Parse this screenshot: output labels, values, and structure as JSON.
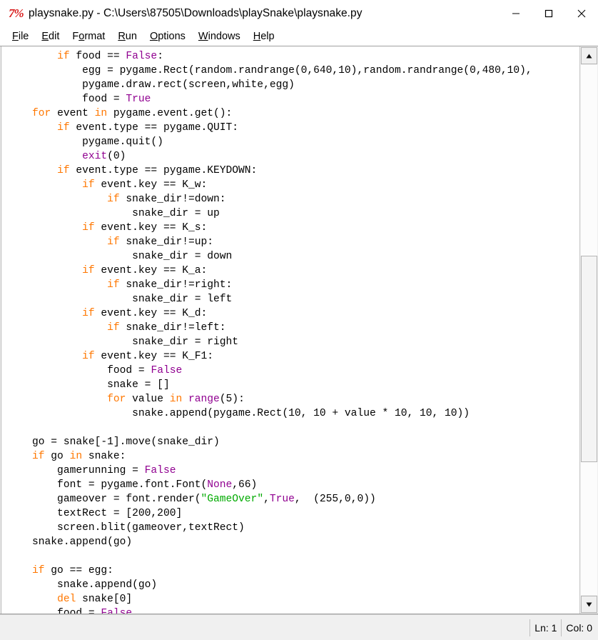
{
  "window": {
    "icon_name": "python-idle-icon",
    "icon_glyph": "7%",
    "title": "playsnake.py - C:\\Users\\87505\\Downloads\\playSnake\\playsnake.py",
    "controls": {
      "minimize": "minimize",
      "maximize": "maximize",
      "close": "close"
    }
  },
  "menubar": {
    "items": [
      {
        "label": "File",
        "accel_index": 0
      },
      {
        "label": "Edit",
        "accel_index": 0
      },
      {
        "label": "Format",
        "accel_index": 1
      },
      {
        "label": "Run",
        "accel_index": 0
      },
      {
        "label": "Options",
        "accel_index": 0
      },
      {
        "label": "Windows",
        "accel_index": 0
      },
      {
        "label": "Help",
        "accel_index": 0
      }
    ]
  },
  "editor": {
    "language": "python",
    "filename": "playsnake.py",
    "lines": [
      [
        {
          "t": "        ",
          "c": ""
        },
        {
          "t": "if",
          "c": "kw"
        },
        {
          "t": " food == ",
          "c": ""
        },
        {
          "t": "False",
          "c": "bi"
        },
        {
          "t": ":",
          "c": ""
        }
      ],
      [
        {
          "t": "            egg = pygame.Rect(random.randrange(0,640,10),random.randrange(0,480,10),",
          "c": ""
        }
      ],
      [
        {
          "t": "            pygame.draw.rect(screen,white,egg)",
          "c": ""
        }
      ],
      [
        {
          "t": "            food = ",
          "c": ""
        },
        {
          "t": "True",
          "c": "bi"
        }
      ],
      [
        {
          "t": "    ",
          "c": ""
        },
        {
          "t": "for",
          "c": "kw"
        },
        {
          "t": " event ",
          "c": ""
        },
        {
          "t": "in",
          "c": "kw"
        },
        {
          "t": " pygame.event.get():",
          "c": ""
        }
      ],
      [
        {
          "t": "        ",
          "c": ""
        },
        {
          "t": "if",
          "c": "kw"
        },
        {
          "t": " event.type == pygame.QUIT:",
          "c": ""
        }
      ],
      [
        {
          "t": "            pygame.quit()",
          "c": ""
        }
      ],
      [
        {
          "t": "            ",
          "c": ""
        },
        {
          "t": "exit",
          "c": "bi"
        },
        {
          "t": "(0)",
          "c": ""
        }
      ],
      [
        {
          "t": "        ",
          "c": ""
        },
        {
          "t": "if",
          "c": "kw"
        },
        {
          "t": " event.type == pygame.KEYDOWN:",
          "c": ""
        }
      ],
      [
        {
          "t": "            ",
          "c": ""
        },
        {
          "t": "if",
          "c": "kw"
        },
        {
          "t": " event.key == K_w:",
          "c": ""
        }
      ],
      [
        {
          "t": "                ",
          "c": ""
        },
        {
          "t": "if",
          "c": "kw"
        },
        {
          "t": " snake_dir!=down:",
          "c": ""
        }
      ],
      [
        {
          "t": "                    snake_dir = up",
          "c": ""
        }
      ],
      [
        {
          "t": "            ",
          "c": ""
        },
        {
          "t": "if",
          "c": "kw"
        },
        {
          "t": " event.key == K_s:",
          "c": ""
        }
      ],
      [
        {
          "t": "                ",
          "c": ""
        },
        {
          "t": "if",
          "c": "kw"
        },
        {
          "t": " snake_dir!=up:",
          "c": ""
        }
      ],
      [
        {
          "t": "                    snake_dir = down",
          "c": ""
        }
      ],
      [
        {
          "t": "            ",
          "c": ""
        },
        {
          "t": "if",
          "c": "kw"
        },
        {
          "t": " event.key == K_a:",
          "c": ""
        }
      ],
      [
        {
          "t": "                ",
          "c": ""
        },
        {
          "t": "if",
          "c": "kw"
        },
        {
          "t": " snake_dir!=right:",
          "c": ""
        }
      ],
      [
        {
          "t": "                    snake_dir = left",
          "c": ""
        }
      ],
      [
        {
          "t": "            ",
          "c": ""
        },
        {
          "t": "if",
          "c": "kw"
        },
        {
          "t": " event.key == K_d:",
          "c": ""
        }
      ],
      [
        {
          "t": "                ",
          "c": ""
        },
        {
          "t": "if",
          "c": "kw"
        },
        {
          "t": " snake_dir!=left:",
          "c": ""
        }
      ],
      [
        {
          "t": "                    snake_dir = right",
          "c": ""
        }
      ],
      [
        {
          "t": "            ",
          "c": ""
        },
        {
          "t": "if",
          "c": "kw"
        },
        {
          "t": " event.key == K_F1:",
          "c": ""
        }
      ],
      [
        {
          "t": "                food = ",
          "c": ""
        },
        {
          "t": "False",
          "c": "bi"
        }
      ],
      [
        {
          "t": "                snake = []",
          "c": ""
        }
      ],
      [
        {
          "t": "                ",
          "c": ""
        },
        {
          "t": "for",
          "c": "kw"
        },
        {
          "t": " value ",
          "c": ""
        },
        {
          "t": "in",
          "c": "kw"
        },
        {
          "t": " ",
          "c": ""
        },
        {
          "t": "range",
          "c": "bi"
        },
        {
          "t": "(5):",
          "c": ""
        }
      ],
      [
        {
          "t": "                    snake.append(pygame.Rect(10, 10 + value * 10, 10, 10))",
          "c": ""
        }
      ],
      [
        {
          "t": "",
          "c": ""
        }
      ],
      [
        {
          "t": "    go = snake[-1].move(snake_dir)",
          "c": ""
        }
      ],
      [
        {
          "t": "    ",
          "c": ""
        },
        {
          "t": "if",
          "c": "kw"
        },
        {
          "t": " go ",
          "c": ""
        },
        {
          "t": "in",
          "c": "kw"
        },
        {
          "t": " snake:",
          "c": ""
        }
      ],
      [
        {
          "t": "        gamerunning = ",
          "c": ""
        },
        {
          "t": "False",
          "c": "bi"
        }
      ],
      [
        {
          "t": "        font = pygame.font.Font(",
          "c": ""
        },
        {
          "t": "None",
          "c": "bi"
        },
        {
          "t": ",66)",
          "c": ""
        }
      ],
      [
        {
          "t": "        gameover = font.render(",
          "c": ""
        },
        {
          "t": "\"GameOver\"",
          "c": "str"
        },
        {
          "t": ",",
          "c": ""
        },
        {
          "t": "True",
          "c": "bi"
        },
        {
          "t": ",  (255,0,0))",
          "c": ""
        }
      ],
      [
        {
          "t": "        textRect = [200,200]",
          "c": ""
        }
      ],
      [
        {
          "t": "        screen.blit(gameover,textRect)",
          "c": ""
        }
      ],
      [
        {
          "t": "    snake.append(go)",
          "c": ""
        }
      ],
      [
        {
          "t": "",
          "c": ""
        }
      ],
      [
        {
          "t": "    ",
          "c": ""
        },
        {
          "t": "if",
          "c": "kw"
        },
        {
          "t": " go == egg:",
          "c": ""
        }
      ],
      [
        {
          "t": "        snake.append(go)",
          "c": ""
        }
      ],
      [
        {
          "t": "        ",
          "c": ""
        },
        {
          "t": "del",
          "c": "kw"
        },
        {
          "t": " snake[0]",
          "c": ""
        }
      ],
      [
        {
          "t": "        food = ",
          "c": ""
        },
        {
          "t": "False",
          "c": "bi"
        }
      ]
    ]
  },
  "scrollbar": {
    "up_arrow_name": "scroll-up-arrow",
    "down_arrow_name": "scroll-down-arrow",
    "thumb_top_pct": 36,
    "thumb_height_pct": 39
  },
  "statusbar": {
    "line": "Ln: 1",
    "column": "Col: 0"
  },
  "colors": {
    "keyword": "#ff7700",
    "builtin": "#900090",
    "string": "#00aa00",
    "text": "#000000",
    "background": "#ffffff",
    "chrome": "#f0f0f0"
  }
}
